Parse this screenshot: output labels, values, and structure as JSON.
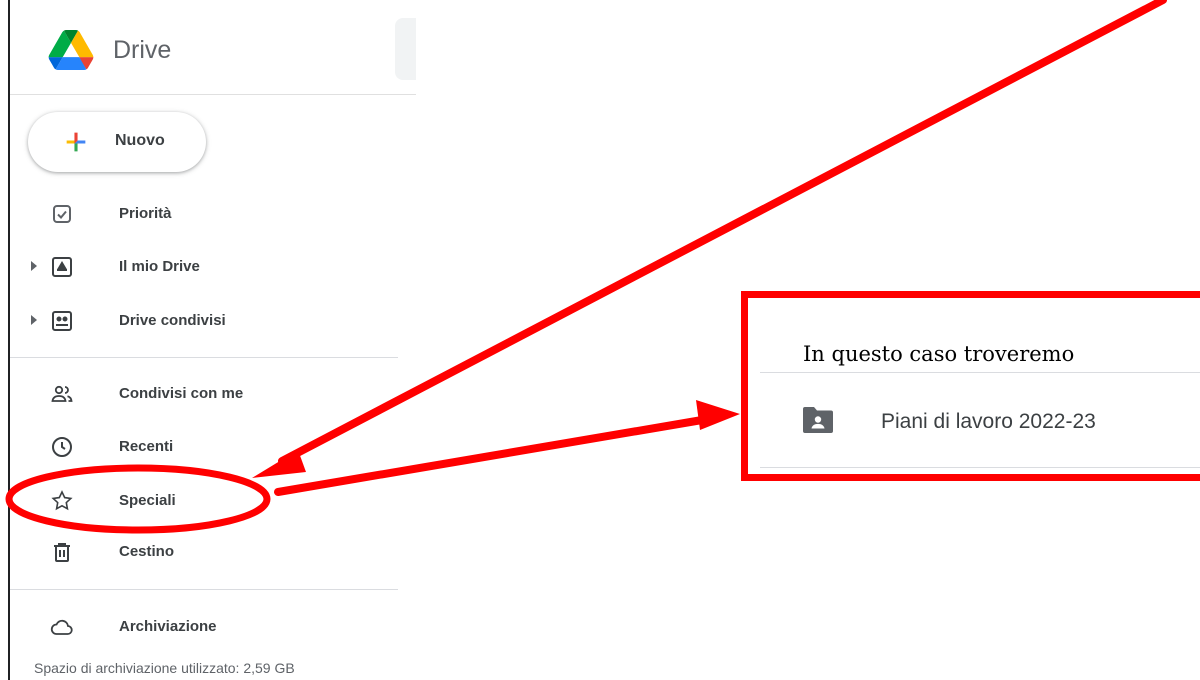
{
  "app": {
    "name": "Drive"
  },
  "new_button": {
    "label": "Nuovo"
  },
  "nav": {
    "primary": [
      {
        "label": "Priorità",
        "icon": "priority-check-icon",
        "expandable": false
      },
      {
        "label": "Il mio Drive",
        "icon": "my-drive-icon",
        "expandable": true
      },
      {
        "label": "Drive condivisi",
        "icon": "shared-drives-icon",
        "expandable": true
      }
    ],
    "secondary": [
      {
        "label": "Condivisi con me",
        "icon": "people-icon"
      },
      {
        "label": "Recenti",
        "icon": "clock-icon"
      },
      {
        "label": "Speciali",
        "icon": "star-icon"
      },
      {
        "label": "Cestino",
        "icon": "trash-icon"
      }
    ],
    "storage": {
      "label": "Archiviazione",
      "icon": "cloud-icon"
    }
  },
  "storage_usage": {
    "text": "Spazio di archiviazione utilizzato: 2,59 GB"
  },
  "callout": {
    "caption": "In questo caso troveremo",
    "folder": {
      "name": "Piani di lavoro 2022-23",
      "icon": "shared-folder-icon"
    }
  },
  "annotation": {
    "color": "#ff0000"
  },
  "colors": {
    "google_blue": "#4285f4",
    "google_red": "#ea4335",
    "google_yellow": "#fbbc04",
    "google_green": "#34a853",
    "icon_gray": "#5f6368",
    "folder_gray": "#5f6368"
  }
}
